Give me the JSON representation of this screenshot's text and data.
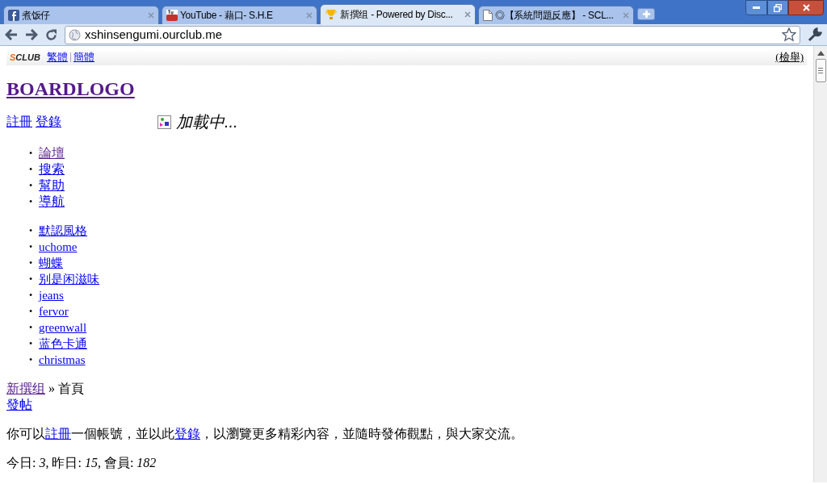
{
  "browser": {
    "tabs": [
      {
        "title": "煮饭仔",
        "kind": "facebook",
        "selected": false
      },
      {
        "title": "YouTube - 藉口- S.H.E",
        "kind": "youtube",
        "selected": false
      },
      {
        "title": "新撰组 - Powered by Disc...",
        "kind": "trophy",
        "selected": true
      },
      {
        "title": "◎【系統問題反應】 - SCL...",
        "kind": "page",
        "selected": false
      }
    ],
    "url": "xshinsengumi.ourclub.me"
  },
  "topbar": {
    "logo": "SCLUB",
    "lang_links": [
      {
        "label": "繁體",
        "visited": false
      },
      {
        "label": "簡體",
        "visited": false
      }
    ],
    "report": "(檢舉)"
  },
  "board_logo": "BOARDLOGO",
  "user_links": [
    {
      "label": "註冊"
    },
    {
      "label": "登錄"
    }
  ],
  "loading": "加載中...",
  "nav": [
    {
      "marker": "•",
      "label": "論壇",
      "visited": true
    },
    {
      "marker": "•",
      "label": "搜索",
      "visited": false
    },
    {
      "marker": "•",
      "label": "幫助",
      "visited": false
    },
    {
      "marker": "•",
      "label": "導航",
      "visited": false
    }
  ],
  "styles": [
    {
      "marker": "•",
      "label": "默認風格",
      "visited": false
    },
    {
      "marker": "•",
      "label": "uchome",
      "visited": false
    },
    {
      "marker": "•",
      "label": "蝴蝶",
      "visited": false
    },
    {
      "marker": "•",
      "label": "别是闲滋味",
      "visited": false
    },
    {
      "marker": "•",
      "label": "jeans",
      "visited": false
    },
    {
      "marker": "•",
      "label": "fervor",
      "visited": false
    },
    {
      "marker": "•",
      "label": "greenwall",
      "visited": false
    },
    {
      "marker": "•",
      "label": "蓝色卡通",
      "visited": false
    },
    {
      "marker": "•",
      "label": "christmas",
      "visited": false
    }
  ],
  "breadcrumb": {
    "link": "新撰组",
    "separator": "»",
    "current": "首頁"
  },
  "post_link": "發帖",
  "welcome": [
    {
      "kind": "text",
      "text": "你可以"
    },
    {
      "kind": "link",
      "text": "註冊"
    },
    {
      "kind": "text",
      "text": "一個帳號，並以此"
    },
    {
      "kind": "link",
      "text": "登錄"
    },
    {
      "kind": "text",
      "text": "，以瀏覽更多精彩內容，並隨時發佈觀點，與大家交流。"
    }
  ],
  "stats": "今日: *3*, 昨日: *15*, 會員: *182*"
}
